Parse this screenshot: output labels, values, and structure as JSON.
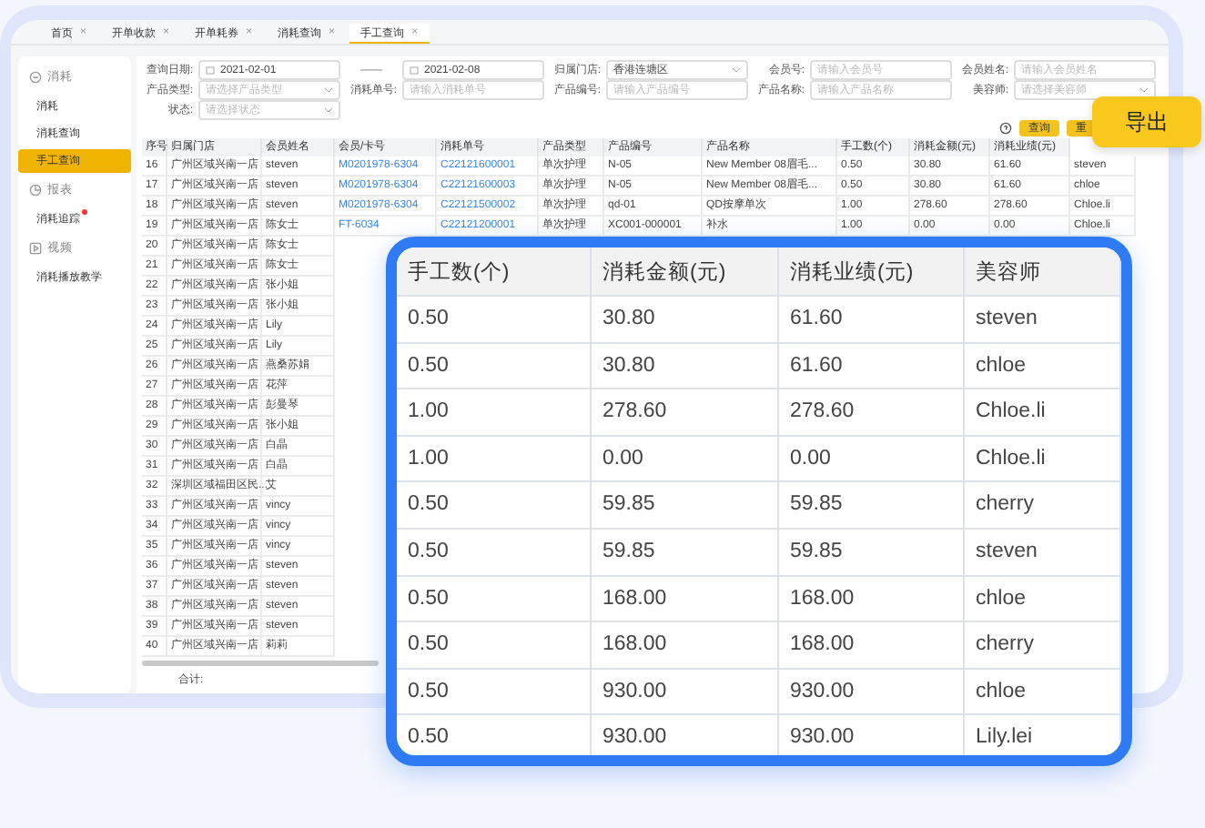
{
  "tabs": [
    {
      "label": "首页",
      "close": "×",
      "selected": false
    },
    {
      "label": "开单收款",
      "close": "×",
      "selected": false
    },
    {
      "label": "开单耗券",
      "close": "×",
      "selected": false
    },
    {
      "label": "消耗查询",
      "close": "×",
      "selected": false
    },
    {
      "label": "手工查询",
      "close": "×",
      "selected": true
    }
  ],
  "sidebar": [
    {
      "title": "消耗",
      "kind": "minus",
      "items": [
        {
          "label": "消耗",
          "selected": false,
          "badge": false
        },
        {
          "label": "消耗查询",
          "selected": false,
          "badge": false
        },
        {
          "label": "手工查询",
          "selected": true,
          "badge": false
        }
      ]
    },
    {
      "title": "报表",
      "kind": "chart",
      "items": [
        {
          "label": "消耗追踪",
          "selected": false,
          "badge": true
        }
      ]
    },
    {
      "title": "视频",
      "kind": "play",
      "items": [
        {
          "label": "消耗播放教学",
          "selected": false,
          "badge": false
        }
      ]
    }
  ],
  "filters": [
    [
      {
        "label": "查询日期:",
        "kind": "daterange",
        "value": "2021-02-01",
        "separator": "——",
        "value_end": "2021-02-08"
      },
      {
        "label": "归属门店:",
        "kind": "select",
        "value": "香港连塘区"
      },
      {
        "label": "会员号:",
        "kind": "text",
        "placeholder": "请输入会员号"
      },
      {
        "label": "会员姓名:",
        "kind": "text",
        "placeholder": "请输入会员姓名"
      }
    ],
    [
      {
        "label": "产品类型:",
        "kind": "select",
        "placeholder": "请选择产品类型"
      },
      {
        "label": "消耗单号:",
        "kind": "text",
        "placeholder": "请输入消耗单号"
      },
      {
        "label": "产品编号:",
        "kind": "text",
        "placeholder": "请输入产品编号"
      },
      {
        "label": "产品名称:",
        "kind": "text",
        "placeholder": "请输入产品名称"
      },
      {
        "label": "美容师:",
        "kind": "select",
        "placeholder": "请选择美容师"
      }
    ],
    [
      {
        "label": "状态:",
        "kind": "select",
        "placeholder": "请选择状态"
      }
    ]
  ],
  "buttons": [
    "查询",
    "重"
  ],
  "table": {
    "columns": [
      "序号",
      "归属门店",
      "会员姓名",
      "会员/卡号",
      "消耗单号",
      "产品类型",
      "产品编号",
      "产品名称",
      "手工数(个)",
      "消耗金额(元)",
      "消耗业绩(元)"
    ],
    "rows": [
      [
        "16",
        "广州区域兴南一店",
        "steven",
        "M0201978-6304",
        "C22121600001",
        "单次护理",
        "N-05",
        "New Member 08眉毛...",
        "0.50",
        "30.80",
        "61.60",
        "steven"
      ],
      [
        "17",
        "广州区域兴南一店",
        "steven",
        "M0201978-6304",
        "C22121600003",
        "单次护理",
        "N-05",
        "New Member 08眉毛...",
        "0.50",
        "30.80",
        "61.60",
        "chloe"
      ],
      [
        "18",
        "广州区域兴南一店",
        "steven",
        "M0201978-6304",
        "C22121500002",
        "单次护理",
        "qd-01",
        "QD按摩单次",
        "1.00",
        "278.60",
        "278.60",
        "Chloe.li"
      ],
      [
        "19",
        "广州区域兴南一店",
        "陈女士",
        "FT-6034",
        "C22121200001",
        "单次护理",
        "XC001-000001",
        "补水",
        "1.00",
        "0.00",
        "0.00",
        "Chloe.li"
      ],
      [
        "20",
        "广州区域兴南一店",
        "陈女士"
      ],
      [
        "21",
        "广州区域兴南一店",
        "陈女士"
      ],
      [
        "22",
        "广州区域兴南一店",
        "张小姐"
      ],
      [
        "23",
        "广州区域兴南一店",
        "张小姐"
      ],
      [
        "24",
        "广州区域兴南一店",
        "Lily"
      ],
      [
        "25",
        "广州区域兴南一店",
        "Lily"
      ],
      [
        "26",
        "广州区域兴南一店",
        "燕桑苏娟"
      ],
      [
        "27",
        "广州区域兴南一店",
        "花萍"
      ],
      [
        "28",
        "广州区域兴南一店",
        "彭曼琴"
      ],
      [
        "29",
        "广州区域兴南一店",
        "张小姐"
      ],
      [
        "30",
        "广州区域兴南一店",
        "白晶"
      ],
      [
        "31",
        "广州区域兴南一店",
        "白晶"
      ],
      [
        "32",
        "深圳区域福田区民...",
        "艾"
      ],
      [
        "33",
        "广州区域兴南一店",
        "vincy"
      ],
      [
        "34",
        "广州区域兴南一店",
        "vincy"
      ],
      [
        "35",
        "广州区域兴南一店",
        "vincy"
      ],
      [
        "36",
        "广州区域兴南一店",
        "steven"
      ],
      [
        "37",
        "广州区域兴南一店",
        "steven"
      ],
      [
        "38",
        "广州区域兴南一店",
        "steven"
      ],
      [
        "39",
        "广州区域兴南一店",
        "steven"
      ],
      [
        "40",
        "广州区域兴南一店",
        "莉莉"
      ]
    ],
    "total_label": "合计:"
  },
  "export_callout": "导出",
  "zoom_panel": {
    "columns": [
      "手工数(个)",
      "消耗金额(元)",
      "消耗业绩(元)",
      "美容师"
    ],
    "rows": [
      [
        "0.50",
        "30.80",
        "61.60",
        "steven"
      ],
      [
        "0.50",
        "30.80",
        "61.60",
        "chloe"
      ],
      [
        "1.00",
        "278.60",
        "278.60",
        "Chloe.li"
      ],
      [
        "1.00",
        "0.00",
        "0.00",
        "Chloe.li"
      ],
      [
        "0.50",
        "59.85",
        "59.85",
        "cherry"
      ],
      [
        "0.50",
        "59.85",
        "59.85",
        "steven"
      ],
      [
        "0.50",
        "168.00",
        "168.00",
        "chloe"
      ],
      [
        "0.50",
        "168.00",
        "168.00",
        "cherry"
      ],
      [
        "0.50",
        "930.00",
        "930.00",
        "chloe"
      ],
      [
        "0.50",
        "930.00",
        "930.00",
        "Lily.lei"
      ]
    ]
  }
}
